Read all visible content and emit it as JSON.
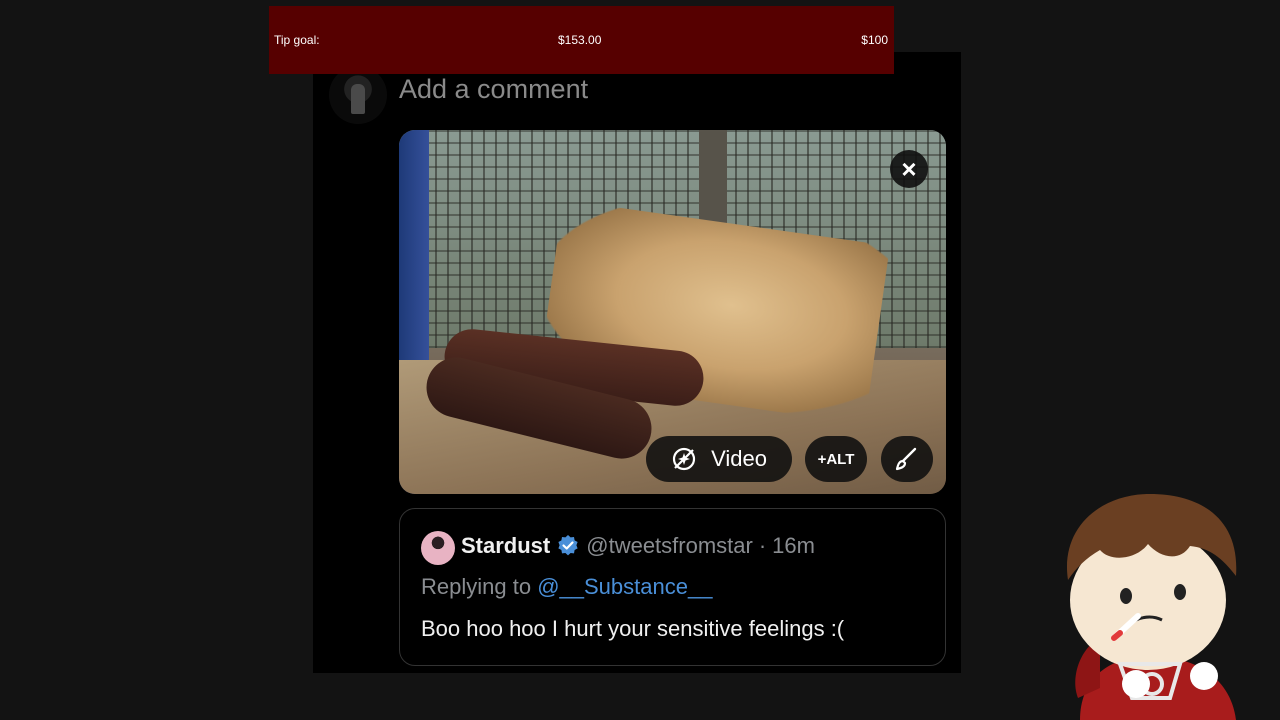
{
  "tip_goal": {
    "label": "Tip goal:",
    "current": "$153.00",
    "target": "$100",
    "progress_fraction": 1.0,
    "color": "#560000"
  },
  "composer": {
    "placeholder": "Add a comment",
    "avatar_icon": "user-avatar"
  },
  "media": {
    "close_icon": "close-icon",
    "video_label": "Video",
    "video_icon": "video-sparkle-icon",
    "alt_label": "+ALT",
    "edit_icon": "brush-icon"
  },
  "quote": {
    "name": "Stardust",
    "verified_icon": "verified-badge-icon",
    "handle": "@tweetsfromstar",
    "separator": "·",
    "time": "16m",
    "replying_prefix": "Replying to",
    "replying_to": "@__Substance__",
    "text": "Boo hoo hoo I hurt your sensitive feelings :("
  },
  "colors": {
    "background": "#131313",
    "panel": "#000000",
    "mention": "#4a8fd8",
    "verified": "#4a8fd8"
  }
}
